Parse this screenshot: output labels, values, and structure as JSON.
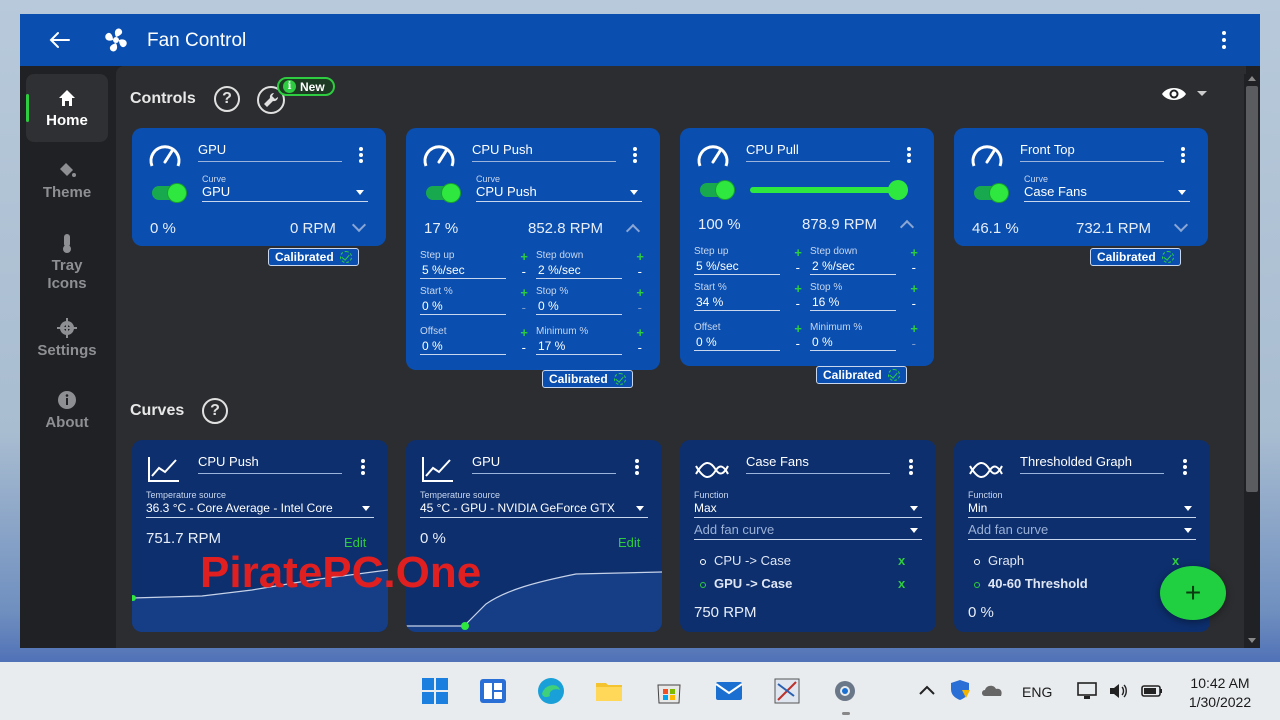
{
  "window": {
    "title": "Fan Control",
    "accent": "#0a4fb0",
    "green": "#2ecc40"
  },
  "sidebar": {
    "items": [
      {
        "label": "Home",
        "icon": "home-icon",
        "active": true
      },
      {
        "label": "Theme",
        "icon": "paint-bucket-icon"
      },
      {
        "label": "Tray Icons",
        "icon": "thermometer-icon"
      },
      {
        "label": "Settings",
        "icon": "gear-icon"
      },
      {
        "label": "About",
        "icon": "info-icon"
      }
    ]
  },
  "controls": {
    "title": "Controls",
    "help": "?",
    "new_badge": "New",
    "cards": [
      {
        "name": "GPU",
        "curve_caption": "Curve",
        "curve": "GPU",
        "percent": "0 %",
        "rpm": "0 RPM",
        "status": "Calibrated"
      },
      {
        "name": "CPU Push",
        "curve_caption": "Curve",
        "curve": "CPU Push",
        "percent": "17 %",
        "rpm": "852.8 RPM",
        "status": "Calibrated",
        "params": [
          {
            "label": "Step up",
            "value": "5 %/sec"
          },
          {
            "label": "Step down",
            "value": "2 %/sec"
          },
          {
            "label": "Start %",
            "value": "0 %"
          },
          {
            "label": "Stop %",
            "value": "0 %"
          },
          {
            "label": "Offset",
            "value": "0 %"
          },
          {
            "label": "Minimum %",
            "value": "17 %"
          }
        ]
      },
      {
        "name": "CPU Pull",
        "percent": "100 %",
        "rpm": "878.9 RPM",
        "status": "Calibrated",
        "slider_level": 1.0,
        "params": [
          {
            "label": "Step up",
            "value": "5 %/sec"
          },
          {
            "label": "Step down",
            "value": "2 %/sec"
          },
          {
            "label": "Start %",
            "value": "34 %"
          },
          {
            "label": "Stop %",
            "value": "16 %"
          },
          {
            "label": "Offset",
            "value": "0 %"
          },
          {
            "label": "Minimum %",
            "value": "0 %"
          }
        ]
      },
      {
        "name": "Front Top",
        "curve_caption": "Curve",
        "curve": "Case Fans",
        "percent": "46.1 %",
        "rpm": "732.1 RPM",
        "status": "Calibrated"
      }
    ]
  },
  "curves": {
    "title": "Curves",
    "help": "?",
    "cards": [
      {
        "name": "CPU Push",
        "source_caption": "Temperature source",
        "source": "36.3 °C - Core Average - Intel Core",
        "value": "751.7 RPM",
        "edit": "Edit"
      },
      {
        "name": "GPU",
        "source_caption": "Temperature source",
        "source": "45 °C - GPU - NVIDIA GeForce GTX",
        "value": "0 %",
        "edit": "Edit"
      },
      {
        "name": "Case Fans",
        "function_caption": "Function",
        "function": "Max",
        "add_placeholder": "Add fan curve",
        "entries": [
          {
            "label": "CPU -> Case",
            "remove": "x"
          },
          {
            "label": "GPU -> Case",
            "remove": "x"
          }
        ],
        "value": "750 RPM"
      },
      {
        "name": "Thresholded Graph",
        "function_caption": "Function",
        "function": "Min",
        "add_placeholder": "Add fan curve",
        "entries": [
          {
            "label": "Graph",
            "remove": "x"
          },
          {
            "label": "40-60 Threshold"
          }
        ],
        "value": "0 %"
      }
    ]
  },
  "fab": "+",
  "watermark": "PiratePC.One",
  "taskbar": {
    "language": "ENG",
    "time": "10:42 AM",
    "date": "1/30/2022"
  }
}
